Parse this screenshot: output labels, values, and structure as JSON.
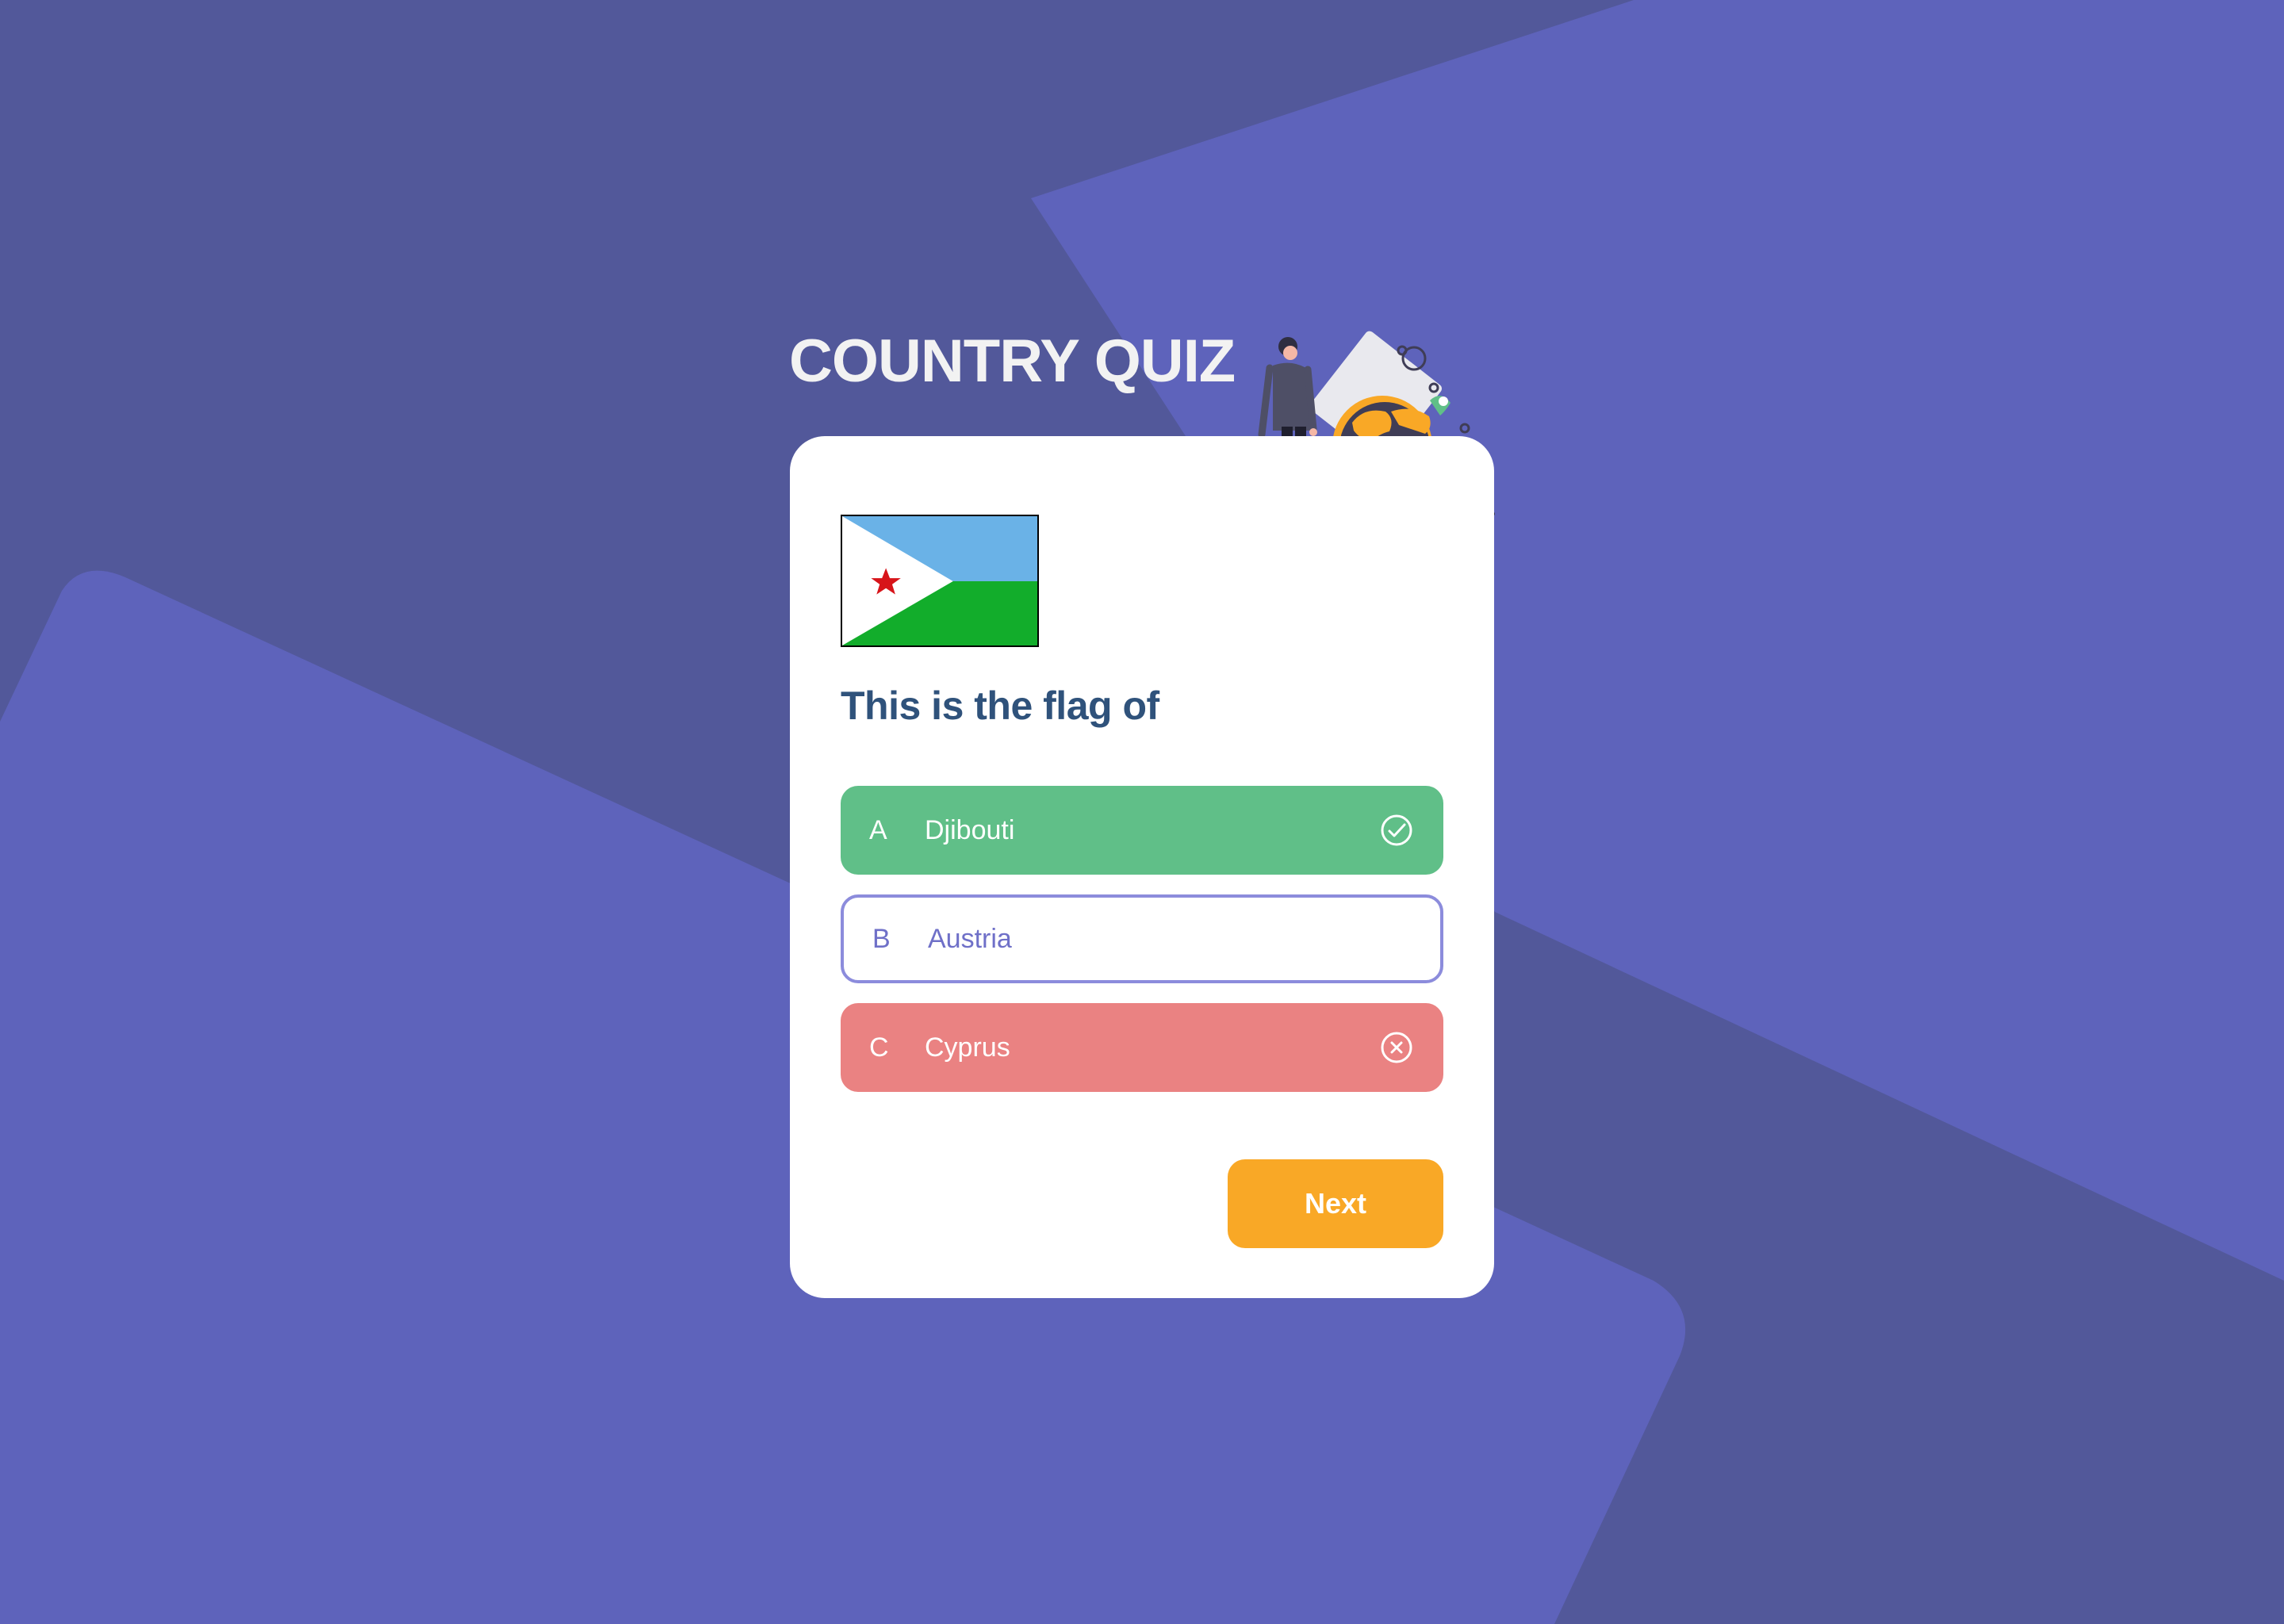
{
  "header": {
    "title": "COUNTRY QUIZ"
  },
  "question": {
    "flag_country": "Djibouti",
    "text": "This is the flag of"
  },
  "answers": [
    {
      "letter": "A",
      "name": "Djibouti",
      "state": "correct",
      "icon": "check-circle-icon"
    },
    {
      "letter": "B",
      "name": "Austria",
      "state": "neutral",
      "icon": null
    },
    {
      "letter": "C",
      "name": "Cyprus",
      "state": "wrong",
      "icon": "x-circle-icon"
    }
  ],
  "actions": {
    "next_label": "Next"
  },
  "colors": {
    "background": "#52589a",
    "background_shape": "#5e63bb",
    "correct": "#60bf88",
    "wrong": "#ea8282",
    "neutral_border": "#8c8cdc",
    "button": "#f9a826",
    "question_text": "#2f527b"
  }
}
